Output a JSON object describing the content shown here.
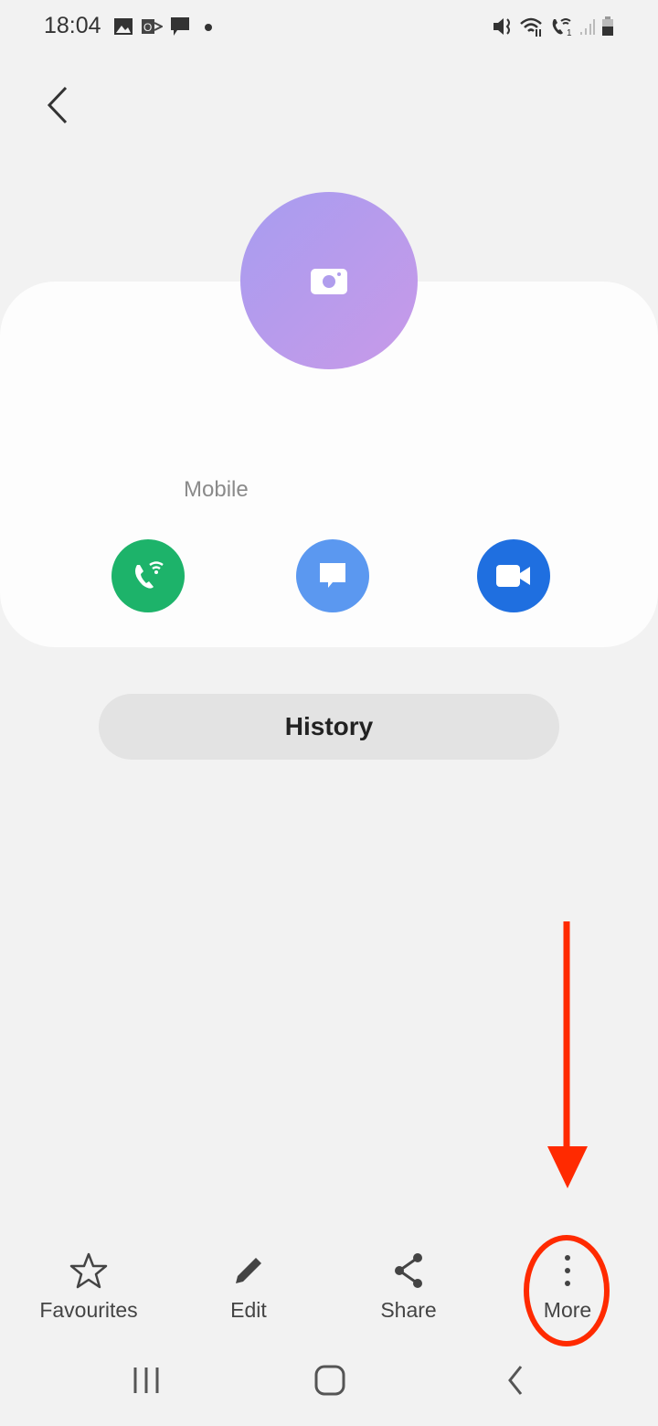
{
  "status_bar": {
    "time": "18:04",
    "left_icons": [
      "gallery-icon",
      "outlook-icon",
      "message-icon",
      "dot-icon"
    ],
    "right_icons": [
      "vibrate-icon",
      "wifi-icon",
      "wifi-call-icon",
      "signal-icon",
      "battery-icon"
    ]
  },
  "header": {
    "back_icon": "chevron-left-icon"
  },
  "contact": {
    "avatar_icon": "camera-icon",
    "phone_label": "Mobile"
  },
  "actions": [
    {
      "name": "wifi-call",
      "icon": "wifi-call-icon",
      "color": "#1db36a"
    },
    {
      "name": "message",
      "icon": "message-icon",
      "color": "#5b98f0"
    },
    {
      "name": "video-call",
      "icon": "video-icon",
      "color": "#1f6fe0"
    }
  ],
  "history_label": "History",
  "bottom_bar": [
    {
      "label": "Favourites",
      "icon": "star-icon"
    },
    {
      "label": "Edit",
      "icon": "pencil-icon"
    },
    {
      "label": "Share",
      "icon": "share-icon"
    },
    {
      "label": "More",
      "icon": "more-vertical-icon"
    }
  ],
  "annotation": {
    "color": "#ff2a00"
  },
  "nav_bar": [
    "recents-icon",
    "home-icon",
    "back-icon"
  ]
}
